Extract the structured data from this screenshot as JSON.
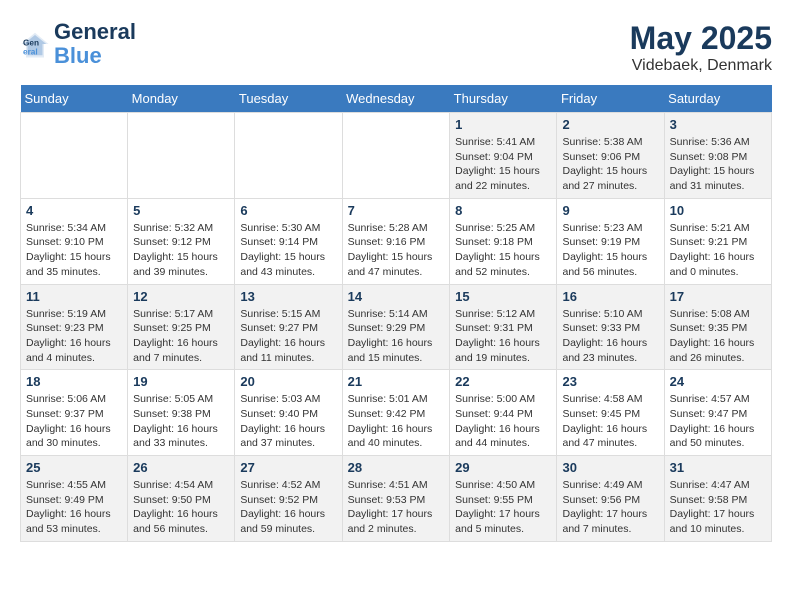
{
  "header": {
    "logo_line1": "General",
    "logo_line2": "Blue",
    "month": "May 2025",
    "location": "Videbaek, Denmark"
  },
  "weekdays": [
    "Sunday",
    "Monday",
    "Tuesday",
    "Wednesday",
    "Thursday",
    "Friday",
    "Saturday"
  ],
  "weeks": [
    [
      {
        "day": "",
        "content": ""
      },
      {
        "day": "",
        "content": ""
      },
      {
        "day": "",
        "content": ""
      },
      {
        "day": "",
        "content": ""
      },
      {
        "day": "1",
        "content": "Sunrise: 5:41 AM\nSunset: 9:04 PM\nDaylight: 15 hours\nand 22 minutes."
      },
      {
        "day": "2",
        "content": "Sunrise: 5:38 AM\nSunset: 9:06 PM\nDaylight: 15 hours\nand 27 minutes."
      },
      {
        "day": "3",
        "content": "Sunrise: 5:36 AM\nSunset: 9:08 PM\nDaylight: 15 hours\nand 31 minutes."
      }
    ],
    [
      {
        "day": "4",
        "content": "Sunrise: 5:34 AM\nSunset: 9:10 PM\nDaylight: 15 hours\nand 35 minutes."
      },
      {
        "day": "5",
        "content": "Sunrise: 5:32 AM\nSunset: 9:12 PM\nDaylight: 15 hours\nand 39 minutes."
      },
      {
        "day": "6",
        "content": "Sunrise: 5:30 AM\nSunset: 9:14 PM\nDaylight: 15 hours\nand 43 minutes."
      },
      {
        "day": "7",
        "content": "Sunrise: 5:28 AM\nSunset: 9:16 PM\nDaylight: 15 hours\nand 47 minutes."
      },
      {
        "day": "8",
        "content": "Sunrise: 5:25 AM\nSunset: 9:18 PM\nDaylight: 15 hours\nand 52 minutes."
      },
      {
        "day": "9",
        "content": "Sunrise: 5:23 AM\nSunset: 9:19 PM\nDaylight: 15 hours\nand 56 minutes."
      },
      {
        "day": "10",
        "content": "Sunrise: 5:21 AM\nSunset: 9:21 PM\nDaylight: 16 hours\nand 0 minutes."
      }
    ],
    [
      {
        "day": "11",
        "content": "Sunrise: 5:19 AM\nSunset: 9:23 PM\nDaylight: 16 hours\nand 4 minutes."
      },
      {
        "day": "12",
        "content": "Sunrise: 5:17 AM\nSunset: 9:25 PM\nDaylight: 16 hours\nand 7 minutes."
      },
      {
        "day": "13",
        "content": "Sunrise: 5:15 AM\nSunset: 9:27 PM\nDaylight: 16 hours\nand 11 minutes."
      },
      {
        "day": "14",
        "content": "Sunrise: 5:14 AM\nSunset: 9:29 PM\nDaylight: 16 hours\nand 15 minutes."
      },
      {
        "day": "15",
        "content": "Sunrise: 5:12 AM\nSunset: 9:31 PM\nDaylight: 16 hours\nand 19 minutes."
      },
      {
        "day": "16",
        "content": "Sunrise: 5:10 AM\nSunset: 9:33 PM\nDaylight: 16 hours\nand 23 minutes."
      },
      {
        "day": "17",
        "content": "Sunrise: 5:08 AM\nSunset: 9:35 PM\nDaylight: 16 hours\nand 26 minutes."
      }
    ],
    [
      {
        "day": "18",
        "content": "Sunrise: 5:06 AM\nSunset: 9:37 PM\nDaylight: 16 hours\nand 30 minutes."
      },
      {
        "day": "19",
        "content": "Sunrise: 5:05 AM\nSunset: 9:38 PM\nDaylight: 16 hours\nand 33 minutes."
      },
      {
        "day": "20",
        "content": "Sunrise: 5:03 AM\nSunset: 9:40 PM\nDaylight: 16 hours\nand 37 minutes."
      },
      {
        "day": "21",
        "content": "Sunrise: 5:01 AM\nSunset: 9:42 PM\nDaylight: 16 hours\nand 40 minutes."
      },
      {
        "day": "22",
        "content": "Sunrise: 5:00 AM\nSunset: 9:44 PM\nDaylight: 16 hours\nand 44 minutes."
      },
      {
        "day": "23",
        "content": "Sunrise: 4:58 AM\nSunset: 9:45 PM\nDaylight: 16 hours\nand 47 minutes."
      },
      {
        "day": "24",
        "content": "Sunrise: 4:57 AM\nSunset: 9:47 PM\nDaylight: 16 hours\nand 50 minutes."
      }
    ],
    [
      {
        "day": "25",
        "content": "Sunrise: 4:55 AM\nSunset: 9:49 PM\nDaylight: 16 hours\nand 53 minutes."
      },
      {
        "day": "26",
        "content": "Sunrise: 4:54 AM\nSunset: 9:50 PM\nDaylight: 16 hours\nand 56 minutes."
      },
      {
        "day": "27",
        "content": "Sunrise: 4:52 AM\nSunset: 9:52 PM\nDaylight: 16 hours\nand 59 minutes."
      },
      {
        "day": "28",
        "content": "Sunrise: 4:51 AM\nSunset: 9:53 PM\nDaylight: 17 hours\nand 2 minutes."
      },
      {
        "day": "29",
        "content": "Sunrise: 4:50 AM\nSunset: 9:55 PM\nDaylight: 17 hours\nand 5 minutes."
      },
      {
        "day": "30",
        "content": "Sunrise: 4:49 AM\nSunset: 9:56 PM\nDaylight: 17 hours\nand 7 minutes."
      },
      {
        "day": "31",
        "content": "Sunrise: 4:47 AM\nSunset: 9:58 PM\nDaylight: 17 hours\nand 10 minutes."
      }
    ]
  ]
}
